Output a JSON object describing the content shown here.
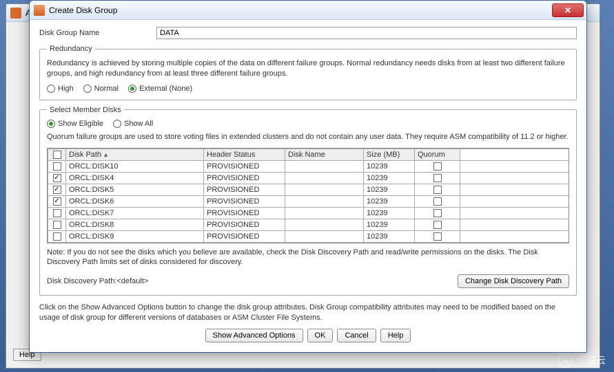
{
  "parent_window": {
    "title_prefix": "AS",
    "help_button": "Help"
  },
  "watermark": {
    "text": "亿速云"
  },
  "dialog": {
    "title": "Create Disk Group",
    "disk_group_name_label": "Disk Group Name",
    "disk_group_name_value": "DATA",
    "redundancy": {
      "legend": "Redundancy",
      "desc": "Redundancy is achieved by storing multiple copies of the data on different failure groups. Normal redundancy needs disks from at least two different failure groups, and high redundancy from at least three different failure groups.",
      "options": [
        {
          "label": "High",
          "selected": false
        },
        {
          "label": "Normal",
          "selected": false
        },
        {
          "label": "External (None)",
          "selected": true
        }
      ]
    },
    "member": {
      "legend": "Select Member Disks",
      "show_options": [
        {
          "label": "Show Eligible",
          "selected": true
        },
        {
          "label": "Show All",
          "selected": false
        }
      ],
      "quorum_desc": "Quorum failure groups are used to store voting files in extended clusters and do not contain any user data. They require ASM compatibility of 11.2 or higher.",
      "columns": {
        "disk_path": "Disk Path",
        "header_status": "Header Status",
        "disk_name": "Disk Name",
        "size_mb": "Size (MB)",
        "quorum": "Quorum"
      },
      "rows": [
        {
          "checked": false,
          "path": "ORCL:DISK10",
          "status": "PROVISIONED",
          "name": "",
          "size": "10239",
          "quorum": false
        },
        {
          "checked": true,
          "path": "ORCL:DISK4",
          "status": "PROVISIONED",
          "name": "",
          "size": "10239",
          "quorum": false
        },
        {
          "checked": true,
          "path": "ORCL:DISK5",
          "status": "PROVISIONED",
          "name": "",
          "size": "10239",
          "quorum": false
        },
        {
          "checked": true,
          "path": "ORCL:DISK6",
          "status": "PROVISIONED",
          "name": "",
          "size": "10239",
          "quorum": false
        },
        {
          "checked": false,
          "path": "ORCL:DISK7",
          "status": "PROVISIONED",
          "name": "",
          "size": "10239",
          "quorum": false
        },
        {
          "checked": false,
          "path": "ORCL:DISK8",
          "status": "PROVISIONED",
          "name": "",
          "size": "10239",
          "quorum": false
        },
        {
          "checked": false,
          "path": "ORCL:DISK9",
          "status": "PROVISIONED",
          "name": "",
          "size": "10239",
          "quorum": false
        }
      ],
      "note": "Note: If you do not see the disks which you believe are available, check the Disk Discovery Path and read/write permissions on the disks. The Disk Discovery Path limits set of disks considered for discovery.",
      "discovery_label": "Disk Discovery Path:<default>",
      "change_path_btn": "Change Disk Discovery Path"
    },
    "bottom_text": "Click on the Show Advanced Options button to change the disk group attributes. Disk Group compatibility attributes may need to be modified based on the usage of disk group for different versions of databases or ASM Cluster File Systems.",
    "buttons": {
      "advanced": "Show Advanced Options",
      "ok": "OK",
      "cancel": "Cancel",
      "help": "Help"
    }
  }
}
